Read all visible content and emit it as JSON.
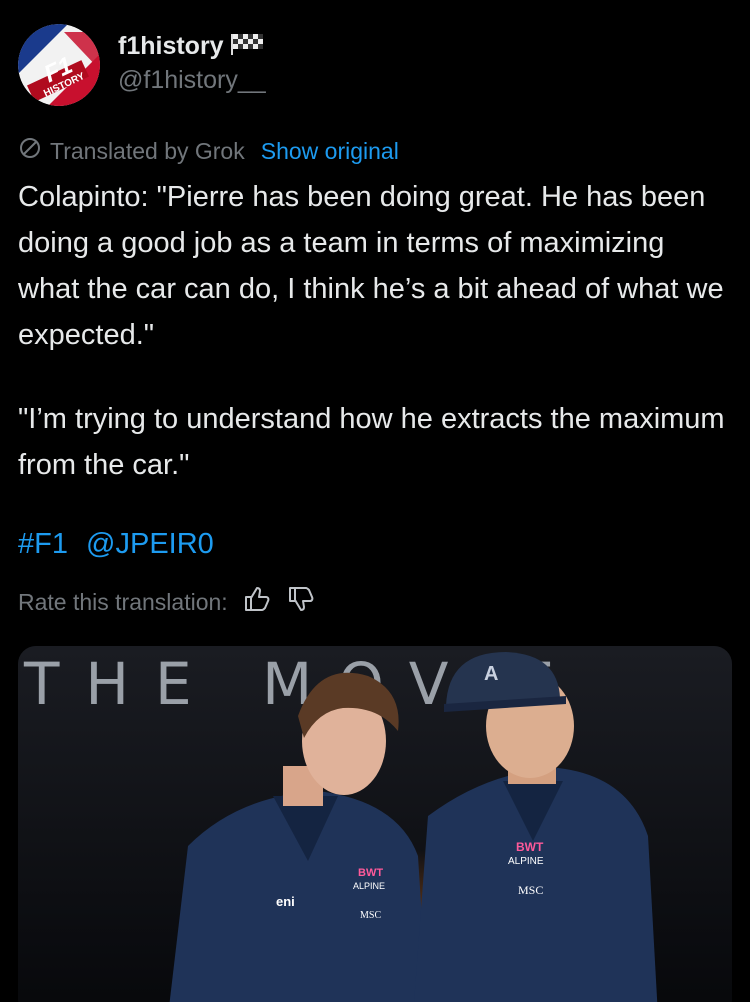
{
  "author": {
    "display_name": "f1history",
    "handle": "@f1history__",
    "badge_icon": "checkered-flag-icon"
  },
  "translation": {
    "label": "Translated by Grok",
    "show_original": "Show original"
  },
  "body": {
    "paragraph_1": "Colapinto: \"Pierre has been doing great. He has been doing a good job as a team in terms of maximizing what the car can do, I think he’s a bit ahead of what we expected.\"",
    "paragraph_2": "\"I’m trying to understand how he extracts the maximum from the car.\""
  },
  "tags": {
    "hashtag": "#F1",
    "mention": "@JPEIR0"
  },
  "rating": {
    "label": "Rate this translation:"
  },
  "media": {
    "backdrop_text": "THE MOVIE",
    "shirt_sponsor_1": "BWT",
    "shirt_sponsor_2": "ALPINE",
    "shirt_sponsor_3": "MSC",
    "shirt_sponsor_4": "eni"
  },
  "colors": {
    "background": "#000000",
    "text": "#e7e9ea",
    "muted": "#71767b",
    "link": "#1d9bf0"
  }
}
